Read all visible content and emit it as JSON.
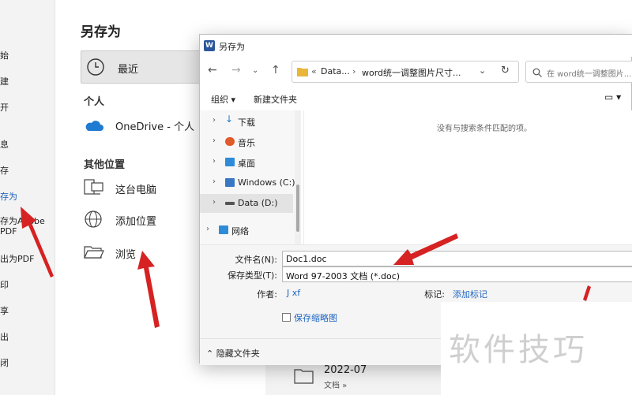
{
  "left_menu": {
    "items": [
      "始",
      "建",
      "开",
      "息",
      "存",
      "存为",
      "存为Adobe PDF",
      "出为PDF",
      "印",
      "享",
      "出",
      "闭"
    ]
  },
  "saveas": {
    "title": "另存为",
    "recent_label": "最近",
    "personal_heading": "个人",
    "onedrive_label": "OneDrive - 个人",
    "other_heading": "其他位置",
    "this_pc_label": "这台电脑",
    "add_location_label": "添加位置",
    "browse_label": "浏览"
  },
  "dialog": {
    "title": "另存为",
    "app_icon_letter": "W",
    "address": {
      "prefix": "«",
      "crumb1": "Data...",
      "separator": "›",
      "crumb2": "word统一调整图片尺寸..."
    },
    "search_placeholder": "在 word统一调整图片...",
    "organize_label": "组织",
    "new_folder_label": "新建文件夹",
    "tree": [
      {
        "label": "下载",
        "color": "#1f7ad1"
      },
      {
        "label": "音乐",
        "color": "#e05a2b"
      },
      {
        "label": "桌面",
        "color": "#2e8bd8"
      },
      {
        "label": "Windows (C:)",
        "color": "#3b78c4"
      },
      {
        "label": "Data (D:)",
        "color": "#555555"
      },
      {
        "label": "网络",
        "color": "#2e8bd8"
      }
    ],
    "empty_message": "没有与搜索条件匹配的项。",
    "file_name_label": "文件名(N):",
    "file_name_value": "Doc1.doc",
    "save_type_label": "保存类型(T):",
    "save_type_value": "Word 97-2003 文档 (*.doc)",
    "author_label": "作者:",
    "author_value": "J xf",
    "tags_label": "标记:",
    "tags_value": "添加标记",
    "thumbnail_label": "保存缩略图",
    "hide_folders_label": "隐藏文件夹"
  },
  "folder_row": {
    "name": "2022-07",
    "location": "文档 »"
  },
  "watermark": {
    "text": "软件技巧"
  },
  "colors": {
    "accent": "#1f66c2",
    "arrow": "#d62222",
    "word_blue": "#2b579a"
  }
}
